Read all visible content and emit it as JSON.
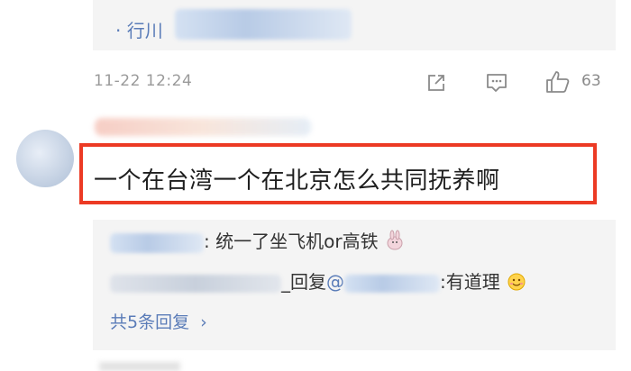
{
  "previous_comment": {
    "prefix": "·",
    "handle": "行川"
  },
  "action_bar": {
    "timestamp": "11-22 12:24",
    "share_icon": "share-icon",
    "comment_icon": "comment-icon",
    "like_icon": "thumbs-up-icon",
    "like_count": "63"
  },
  "comment": {
    "text": "一个在台湾一个在北京怎么共同抚养啊",
    "highlight_color": "#ec3a24"
  },
  "replies": {
    "items": [
      {
        "separator": ":",
        "text": "统一了坐飞机or高铁",
        "emoji": "bunny-emoji"
      },
      {
        "action": "_回复",
        "mention": "@",
        "separator": ":",
        "text": "有道理",
        "emoji": "smile-emoji"
      }
    ],
    "more_label": "共5条回复",
    "more_chevron": "›"
  },
  "colors": {
    "link": "#5a7cb8",
    "panel_bg": "#f4f4f4",
    "muted": "#9a9a9a"
  }
}
